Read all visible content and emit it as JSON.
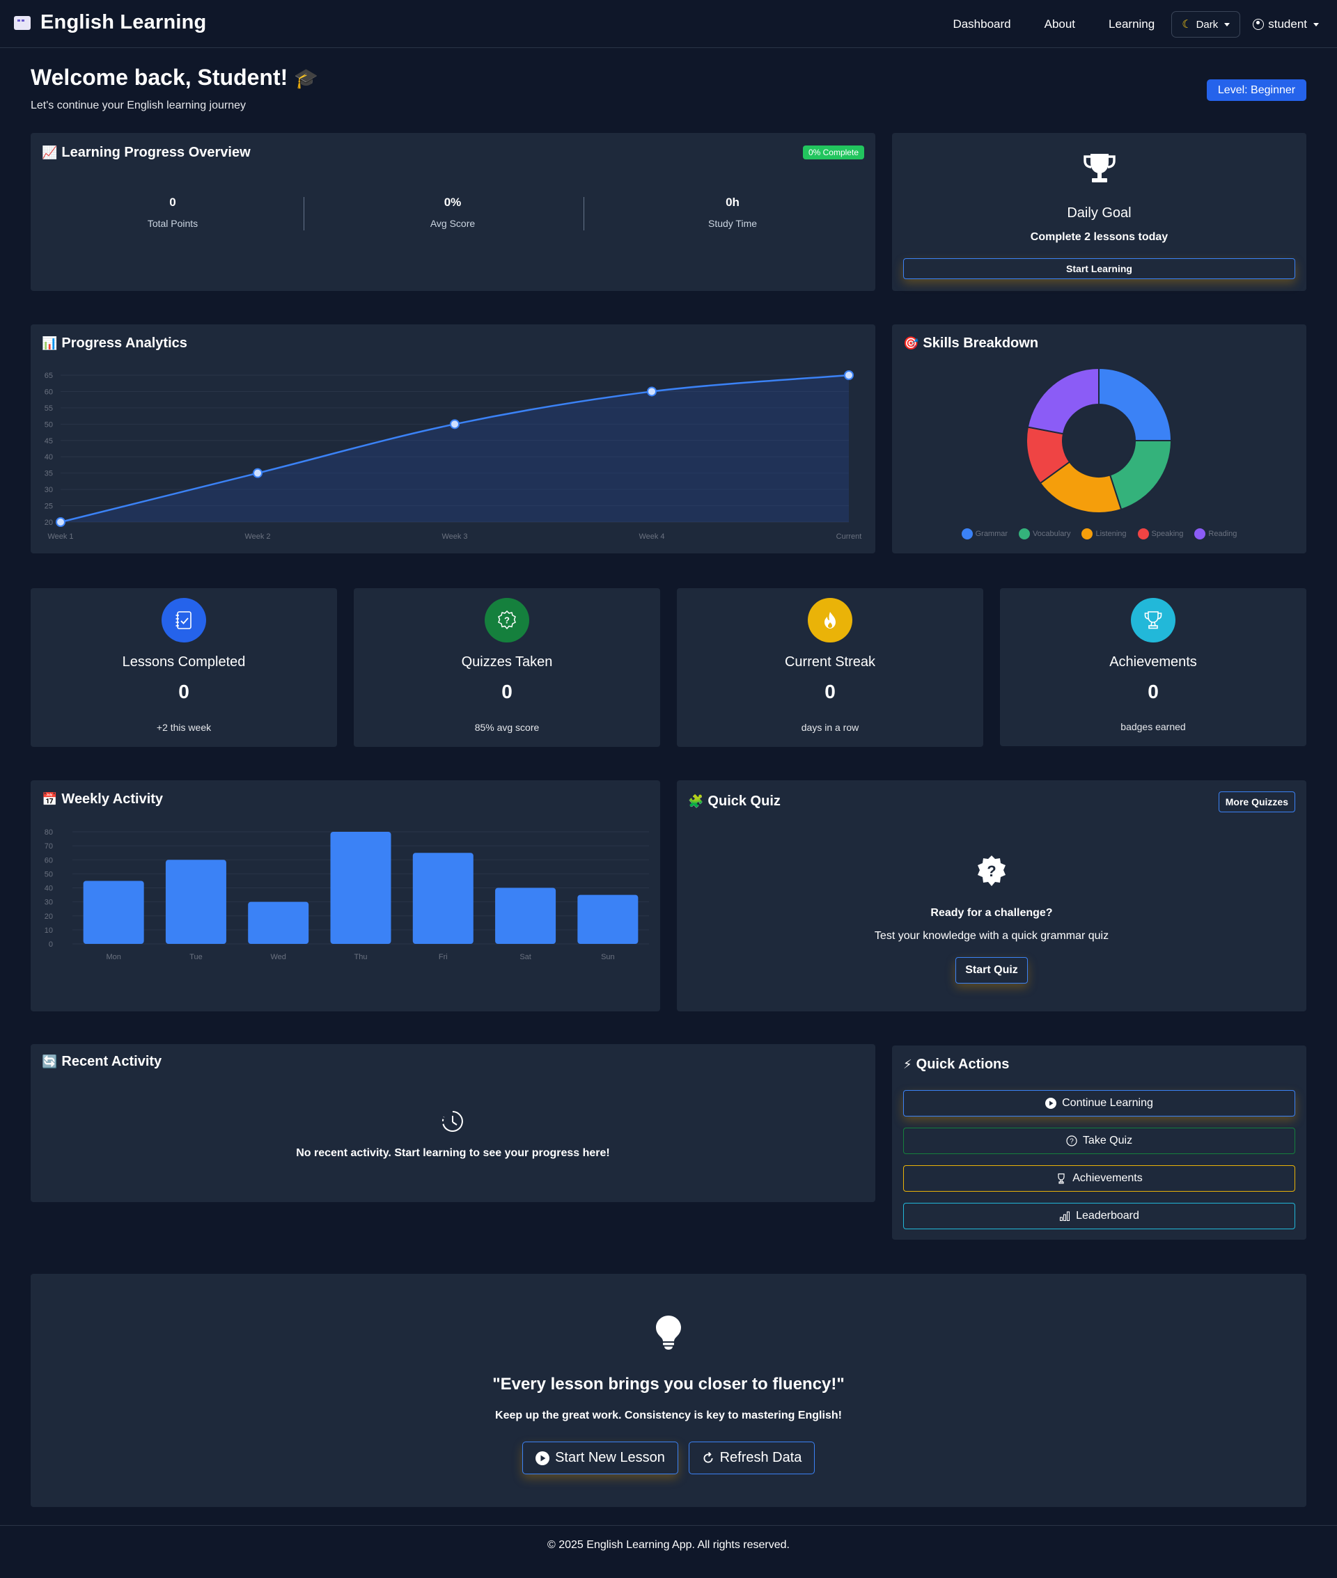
{
  "navbar": {
    "brand": "English Learning",
    "links": [
      "Dashboard",
      "About",
      "Learning"
    ],
    "theme_label": "Dark",
    "user_label": "student"
  },
  "welcome": {
    "title": "Welcome back, Student!",
    "subtitle": "Let's continue your English learning journey",
    "level": "Level: Beginner"
  },
  "overview": {
    "title": "Learning Progress Overview",
    "badge": "0% Complete",
    "stats": [
      {
        "value": "0",
        "label": "Total Points"
      },
      {
        "value": "0%",
        "label": "Avg Score"
      },
      {
        "value": "0h",
        "label": "Study Time"
      }
    ]
  },
  "daily_goal": {
    "title": "Daily Goal",
    "subtitle": "Complete 2 lessons today",
    "button": "Start Learning"
  },
  "analytics": {
    "title": "Progress Analytics"
  },
  "skills": {
    "title": "Skills Breakdown"
  },
  "stat_cards": [
    {
      "title": "Lessons Completed",
      "value": "0",
      "sub": "+2 this week",
      "color": "#2563eb",
      "icon": "checklist-icon"
    },
    {
      "title": "Quizzes Taken",
      "value": "0",
      "sub": "85% avg score",
      "color": "#15803d",
      "icon": "question-badge-icon"
    },
    {
      "title": "Current Streak",
      "value": "0",
      "sub": "days in a row",
      "color": "#eab308",
      "icon": "fire-icon"
    },
    {
      "title": "Achievements",
      "value": "0",
      "sub": "badges earned",
      "color": "#22b8d9",
      "icon": "trophy-icon"
    }
  ],
  "weekly": {
    "title": "Weekly Activity"
  },
  "quick_quiz": {
    "title": "Quick Quiz",
    "more": "More Quizzes",
    "line1": "Ready for a challenge?",
    "line2": "Test your knowledge with a quick grammar quiz",
    "button": "Start Quiz"
  },
  "recent": {
    "title": "Recent Activity",
    "empty": "No recent activity. Start learning to see your progress here!"
  },
  "quick_actions": {
    "title": "Quick Actions",
    "buttons": [
      {
        "label": "Continue Learning",
        "color": "#3b82f6"
      },
      {
        "label": "Take Quiz",
        "color": "#15803d"
      },
      {
        "label": "Achievements",
        "color": "#eab308"
      },
      {
        "label": "Leaderboard",
        "color": "#22b8d9"
      }
    ]
  },
  "quote": {
    "text": "\"Every lesson brings you closer to fluency!\"",
    "sub": "Keep up the great work. Consistency is key to mastering English!",
    "btn1": "Start New Lesson",
    "btn2": "Refresh Data"
  },
  "footer": "© 2025 English Learning App. All rights reserved.",
  "chart_data": [
    {
      "type": "line",
      "x": [
        "Week 1",
        "Week 2",
        "Week 3",
        "Week 4",
        "Current"
      ],
      "values": [
        20,
        35,
        50,
        60,
        65
      ],
      "ylim": [
        20,
        65
      ],
      "yticks": [
        20,
        25,
        30,
        35,
        40,
        45,
        50,
        55,
        60,
        65
      ],
      "color": "#3b82f6",
      "grid": true
    },
    {
      "type": "pie",
      "categories": [
        "Grammar",
        "Vocabulary",
        "Listening",
        "Speaking",
        "Reading"
      ],
      "values": [
        25,
        20,
        20,
        13,
        22
      ],
      "colors": [
        "#3b82f6",
        "#34b27b",
        "#f59e0b",
        "#ef4444",
        "#8b5cf6"
      ],
      "legend": "bottom"
    },
    {
      "type": "bar",
      "categories": [
        "Mon",
        "Tue",
        "Wed",
        "Thu",
        "Fri",
        "Sat",
        "Sun"
      ],
      "values": [
        45,
        60,
        30,
        80,
        65,
        40,
        35
      ],
      "ylim": [
        0,
        80
      ],
      "yticks": [
        0,
        10,
        20,
        30,
        40,
        50,
        60,
        70,
        80
      ],
      "color": "#3b82f6",
      "grid": true
    }
  ]
}
